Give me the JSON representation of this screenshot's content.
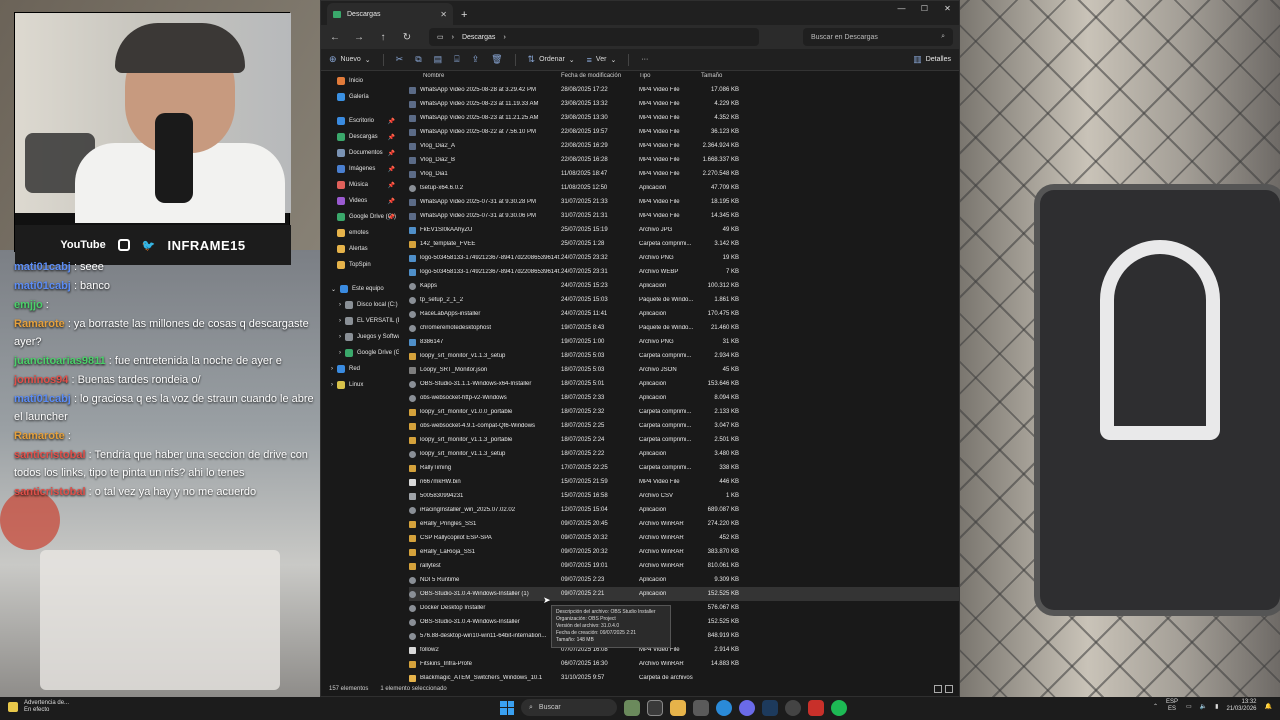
{
  "overlay": {
    "social_youtube": "YouTube",
    "brand": "INFRAME15"
  },
  "chat": [
    {
      "user": "mati01cabj",
      "text": ": seee",
      "color": "#5c8df6"
    },
    {
      "user": "mati01cabj",
      "text": ": banco",
      "color": "#5c8df6"
    },
    {
      "user": "emjjo",
      "text": ":",
      "color": "#4bd06a"
    },
    {
      "user": "Ramarote",
      "text": ": ya borraste las millones de cosas q descargaste ayer?",
      "color": "#e5a03c"
    },
    {
      "user": "juancitoarias9811",
      "text": ": fue entretenida la noche de ayer e",
      "color": "#4bd06a"
    },
    {
      "user": "jominos94",
      "text": ": Buenas tardes rondeia o/",
      "color": "#e0504a"
    },
    {
      "user": "mati01cabj",
      "text": ": lo graciosa q es la voz de straun cuando le abre el launcher",
      "color": "#5c8df6"
    },
    {
      "user": "Ramarote",
      "text": ":",
      "color": "#e5a03c"
    },
    {
      "user": "santicristobal",
      "text": ": Tendria que haber una seccion de drive con todos los links, tipo te pinta un nfs? ahi lo tenes",
      "color": "#e0504a"
    },
    {
      "user": "santicristobal",
      "text": ": o tal vez ya hay y no me acuerdo",
      "color": "#e0504a"
    }
  ],
  "explorer": {
    "tab_title": "Descargas",
    "path": "Descargas",
    "search_placeholder": "Buscar en Descargas",
    "cmd_new": "Nuevo",
    "cmd_sort": "Ordenar",
    "cmd_view": "Ver",
    "cmd_details": "Detalles",
    "columns": {
      "name": "Nombre",
      "date": "Fecha de modificación",
      "type": "Tipo",
      "size": "Tamaño"
    },
    "nav": [
      {
        "label": "Inicio",
        "color": "#e27b3a",
        "kind": "top"
      },
      {
        "label": "Galería",
        "color": "#3a90e2",
        "kind": "top"
      },
      {
        "gap": true
      },
      {
        "label": "Escritorio",
        "color": "#3a8be0",
        "pin": true
      },
      {
        "label": "Descargas",
        "color": "#3aa86b",
        "pin": true
      },
      {
        "label": "Documentos",
        "color": "#7a93b4",
        "pin": true
      },
      {
        "label": "Imágenes",
        "color": "#4a7fd0",
        "pin": true
      },
      {
        "label": "Música",
        "color": "#e0605a",
        "pin": true
      },
      {
        "label": "Videos",
        "color": "#9a5ad0",
        "pin": true
      },
      {
        "label": "Google Drive (G:)",
        "color": "#3aa86b",
        "pin": true
      },
      {
        "label": "emotes",
        "color": "#e6b34a"
      },
      {
        "label": "Alertas",
        "color": "#e6b34a"
      },
      {
        "label": "TopSpin",
        "color": "#e6b34a"
      },
      {
        "gap": true
      },
      {
        "label": "Este equipo",
        "color": "#3a8be0",
        "kind": "tree"
      },
      {
        "label": "Disco local (C:)",
        "color": "#8a9096",
        "kind": "sub"
      },
      {
        "label": "EL VERSATIL (D:)",
        "color": "#8a9096",
        "kind": "sub"
      },
      {
        "label": "Juegos y Software",
        "color": "#8a9096",
        "kind": "sub"
      },
      {
        "label": "Google Drive (G:)",
        "color": "#3aa86b",
        "kind": "sub"
      },
      {
        "label": "Red",
        "color": "#3a8be0",
        "kind": "tree"
      },
      {
        "label": "Linux",
        "color": "#d8c24a",
        "kind": "tree"
      }
    ],
    "files": [
      {
        "name": "WhatsApp Video 2025-08-28 at 3.29.42 PM",
        "date": "28/08/2025 17:22",
        "type": "MP4 Video File",
        "size": "17.086 KB",
        "icon": "video"
      },
      {
        "name": "WhatsApp Video 2025-08-23 at 11.19.33 AM",
        "date": "23/08/2025 13:32",
        "type": "MP4 Video File",
        "size": "4.229 KB",
        "icon": "video"
      },
      {
        "name": "WhatsApp Video 2025-08-23 at 11.21.25 AM",
        "date": "23/08/2025 13:30",
        "type": "MP4 Video File",
        "size": "4.352 KB",
        "icon": "video"
      },
      {
        "name": "WhatsApp Video 2025-08-22 at 7.56.10 PM",
        "date": "22/08/2025 19:57",
        "type": "MP4 Video File",
        "size": "36.123 KB",
        "icon": "video"
      },
      {
        "name": "Vlog_Dia2_A",
        "date": "22/08/2025 16:29",
        "type": "MP4 Video File",
        "size": "2.364.924 KB",
        "icon": "video"
      },
      {
        "name": "Vlog_Dia2_B",
        "date": "22/08/2025 16:28",
        "type": "MP4 Video File",
        "size": "1.668.337 KB",
        "icon": "video"
      },
      {
        "name": "Vlog_Dia1",
        "date": "11/08/2025 18:47",
        "type": "MP4 Video File",
        "size": "2.270.548 KB",
        "icon": "video"
      },
      {
        "name": "tsetup-x64.6.0.2",
        "date": "11/08/2025 12:50",
        "type": "Aplicación",
        "size": "47.709 KB",
        "icon": "app"
      },
      {
        "name": "WhatsApp Video 2025-07-31 at 9.30.28 PM",
        "date": "31/07/2025 21:33",
        "type": "MP4 Video File",
        "size": "18.195 KB",
        "icon": "video"
      },
      {
        "name": "WhatsApp Video 2025-07-31 at 9.30.06 PM",
        "date": "31/07/2025 21:31",
        "type": "MP4 Video File",
        "size": "14.345 KB",
        "icon": "video"
      },
      {
        "name": "FkEV1SI0kAAhyZU",
        "date": "25/07/2025 15:19",
        "type": "Archivo JPG",
        "size": "49 KB",
        "icon": "image"
      },
      {
        "name": "142_template_FVEE",
        "date": "25/07/2025 1:28",
        "type": "Carpeta comprimi...",
        "size": "3.142 KB",
        "icon": "zip"
      },
      {
        "name": "logo-503458133-1749212367-89417d22086539614f...",
        "date": "24/07/2025 23:32",
        "type": "Archivo PNG",
        "size": "19 KB",
        "icon": "image"
      },
      {
        "name": "logo-503458133-1749212367-89417d22086539614f...",
        "date": "24/07/2025 23:31",
        "type": "Archivo WEBP",
        "size": "7 KB",
        "icon": "image"
      },
      {
        "name": "Kapps",
        "date": "24/07/2025 15:23",
        "type": "Aplicación",
        "size": "100.312 KB",
        "icon": "app"
      },
      {
        "name": "tp_setup_2_1_2",
        "date": "24/07/2025 15:03",
        "type": "Paquete de Windo...",
        "size": "1.861 KB",
        "icon": "app"
      },
      {
        "name": "RaceLabApps-installer",
        "date": "24/07/2025 11:41",
        "type": "Aplicación",
        "size": "170.475 KB",
        "icon": "app"
      },
      {
        "name": "chromeremotedesktophost",
        "date": "19/07/2025 8:43",
        "type": "Paquete de Windo...",
        "size": "21.460 KB",
        "icon": "app"
      },
      {
        "name": "8386147",
        "date": "19/07/2025 1:00",
        "type": "Archivo PNG",
        "size": "31 KB",
        "icon": "image"
      },
      {
        "name": "loopy_srt_monitor_v1.1.3_setup",
        "date": "18/07/2025 5:03",
        "type": "Carpeta comprimi...",
        "size": "2.934 KB",
        "icon": "zip"
      },
      {
        "name": "Loopy_SRT_Monitor.json",
        "date": "18/07/2025 5:03",
        "type": "Archivo JSON",
        "size": "45 KB",
        "icon": "json"
      },
      {
        "name": "OBS-Studio-31.1.1-Windows-x64-Installer",
        "date": "18/07/2025 5:01",
        "type": "Aplicación",
        "size": "153.646 KB",
        "icon": "app"
      },
      {
        "name": "obs-websocket-http-v2-Windows",
        "date": "18/07/2025 2:33",
        "type": "Aplicación",
        "size": "8.094 KB",
        "icon": "app"
      },
      {
        "name": "loopy_srt_monitor_v1.0.0_portable",
        "date": "18/07/2025 2:32",
        "type": "Carpeta comprimi...",
        "size": "2.133 KB",
        "icon": "zip"
      },
      {
        "name": "obs-websocket-4.9.1-compat-Qt6-Windows",
        "date": "18/07/2025 2:25",
        "type": "Carpeta comprimi...",
        "size": "3.047 KB",
        "icon": "zip"
      },
      {
        "name": "loopy_srt_monitor_v1.1.3_portable",
        "date": "18/07/2025 2:24",
        "type": "Carpeta comprimi...",
        "size": "2.501 KB",
        "icon": "zip"
      },
      {
        "name": "loopy_srt_monitor_v1.1.3_setup",
        "date": "18/07/2025 2:22",
        "type": "Aplicación",
        "size": "3.480 KB",
        "icon": "app"
      },
      {
        "name": "RallyTiming",
        "date": "17/07/2025 22:25",
        "type": "Carpeta comprimi...",
        "size": "338 KB",
        "icon": "zip"
      },
      {
        "name": "n667mkHW.bin",
        "date": "15/07/2025 21:59",
        "type": "MP4 Video File",
        "size": "446 KB",
        "icon": "doc"
      },
      {
        "name": "5005830994231",
        "date": "15/07/2025 16:58",
        "type": "Archivo CSV",
        "size": "1 KB",
        "icon": "csv"
      },
      {
        "name": "iRacingInstaller_win_2025.07.02.02",
        "date": "12/07/2025 15:04",
        "type": "Aplicación",
        "size": "689.087 KB",
        "icon": "app"
      },
      {
        "name": "eRally_Pringles_SS1",
        "date": "09/07/2025 20:45",
        "type": "Archivo WinRAR",
        "size": "274.220 KB",
        "icon": "zip"
      },
      {
        "name": "CSP Rallycopilot ESP-SPA",
        "date": "09/07/2025 20:32",
        "type": "Archivo WinRAR",
        "size": "452 KB",
        "icon": "zip"
      },
      {
        "name": "eRally_LaRioja_SS1",
        "date": "09/07/2025 20:32",
        "type": "Archivo WinRAR",
        "size": "383.870 KB",
        "icon": "zip"
      },
      {
        "name": "rallytest",
        "date": "09/07/2025 19:01",
        "type": "Archivo WinRAR",
        "size": "810.061 KB",
        "icon": "zip"
      },
      {
        "name": "NDI 5 Runtime",
        "date": "09/07/2025 2:23",
        "type": "Aplicación",
        "size": "9.309 KB",
        "icon": "app"
      },
      {
        "name": "OBS-Studio-31.0.4-Windows-Installer (1)",
        "date": "09/07/2025 2:21",
        "type": "Aplicación",
        "size": "152.525 KB",
        "icon": "app",
        "selected": true
      },
      {
        "name": "Docker Desktop Installer",
        "date": "",
        "type": "",
        "size": "576.067 KB",
        "icon": "app"
      },
      {
        "name": "OBS-Studio-31.0.4-Windows-Installer",
        "date": "",
        "type": "",
        "size": "152.525 KB",
        "icon": "app"
      },
      {
        "name": "576.88-desktop-win10-win11-64bit-internation...",
        "date": "",
        "type": "",
        "size": "848.919 KB",
        "icon": "app"
      },
      {
        "name": "follow2",
        "date": "07/07/2025 16:08",
        "type": "MP4 Video File",
        "size": "2.914 KB",
        "icon": "doc"
      },
      {
        "name": "Fitskins_Infra-Profe",
        "date": "06/07/2025 16:30",
        "type": "Archivo WinRAR",
        "size": "14.883 KB",
        "icon": "zip"
      },
      {
        "name": "Blackmagic_ATEM_Switchers_Windows_10.1",
        "date": "31/10/2025 9:57",
        "type": "Carpeta de archivos",
        "size": "",
        "icon": "folder"
      }
    ],
    "tooltip": [
      "Descripción del archivo: OBS Studio Installer",
      "Organización: OBS Project",
      "Versión del archivo: 31.0.4.0",
      "Fecha de creación: 09/07/2025 2:21",
      "Tamaño: 148 MB"
    ],
    "status_count": "157 elementos",
    "status_selected": "1 elemento seleccionado"
  },
  "taskbar": {
    "weather_title": "Advertencia de...",
    "weather_sub": "En efecto",
    "search": "Buscar",
    "lang_top": "ESP",
    "lang_bottom": "ES",
    "time": "13:32",
    "date": "21/03/2026"
  }
}
